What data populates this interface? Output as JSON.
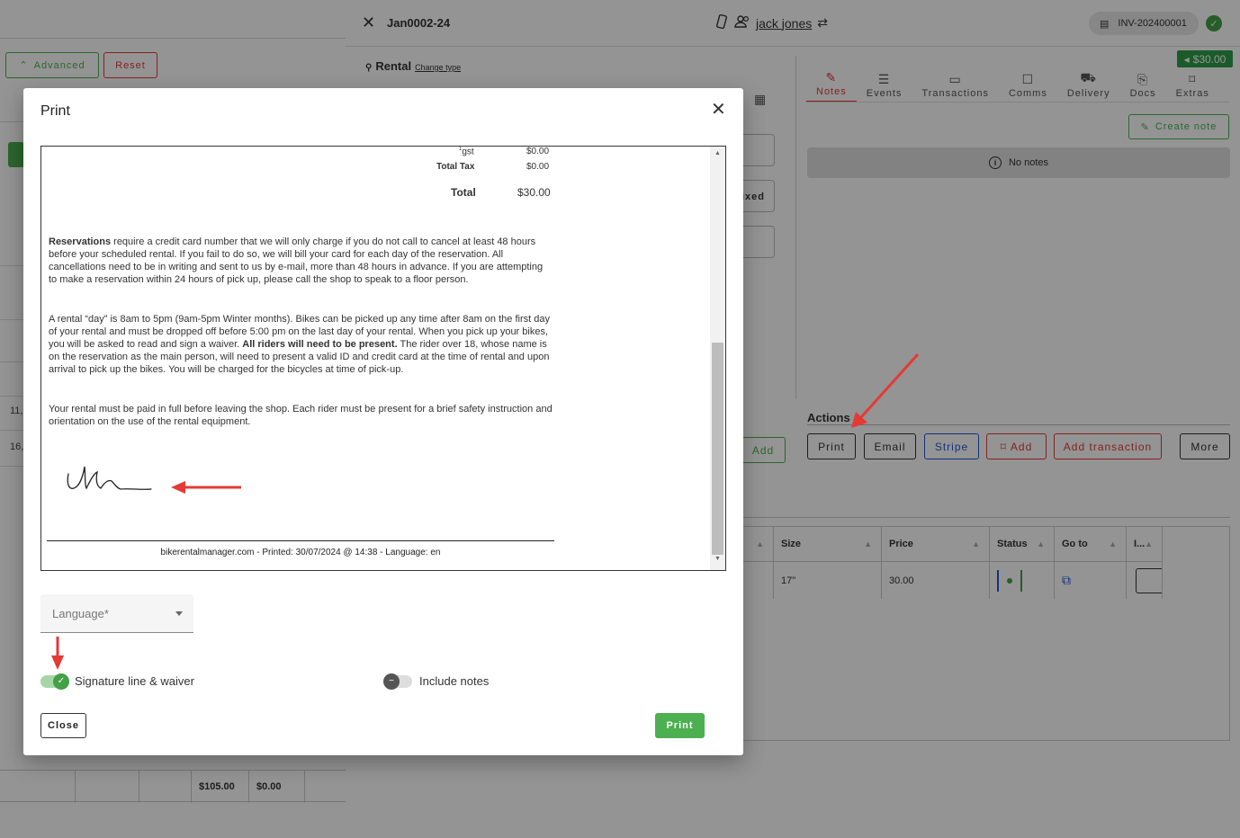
{
  "background": {
    "left": {
      "advanced_label": "Advanced",
      "reset_label": "Reset",
      "row_values": [
        "11,",
        "16,"
      ],
      "totals": [
        "$105.00",
        "$0.00"
      ]
    },
    "header": {
      "reservation_id": "Jan0002-24",
      "customer_name": "jack jones",
      "invoice_number": "INV-202400001",
      "price_badge": "$30.00"
    },
    "rental": {
      "type_label": "Rental",
      "change_type_label": "Change type",
      "fixed_label": "ixed",
      "add_label": "Add"
    },
    "tabs": [
      {
        "label": "Notes",
        "icon": "note-icon"
      },
      {
        "label": "Events",
        "icon": "events-icon"
      },
      {
        "label": "Transactions",
        "icon": "transactions-icon"
      },
      {
        "label": "Comms",
        "icon": "comms-icon"
      },
      {
        "label": "Delivery",
        "icon": "truck-icon"
      },
      {
        "label": "Docs",
        "icon": "docs-icon"
      },
      {
        "label": "Extras",
        "icon": "extras-icon"
      }
    ],
    "notes": {
      "create_label": "Create note",
      "empty_label": "No notes"
    },
    "actions": {
      "title": "Actions",
      "print": "Print",
      "email": "Email",
      "stripe": "Stripe",
      "add": "Add",
      "add_transaction": "Add transaction",
      "more": "More"
    },
    "table": {
      "headers": [
        "Size",
        "Price",
        "Status",
        "Go to",
        "I..."
      ],
      "row": {
        "size": "17\"",
        "price": "30.00"
      }
    }
  },
  "dialog": {
    "title": "Print",
    "preview": {
      "gst_label": "gst",
      "gst_value": "$0.00",
      "total_tax_label": "Total Tax",
      "total_tax_value": "$0.00",
      "total_label": "Total",
      "total_value": "$30.00",
      "para1_bold": "Reservations",
      "para1": " require a credit card number that we will only charge if you do not call to cancel at least 48 hours before your scheduled rental. If you fail to do so, we will bill your card for each day of the reservation. All cancellations need to be in writing and sent to us by e-mail, more than 48 hours in advance. If you are attempting to make a reservation within 24 hours of pick up, please call the shop to speak to a floor person.",
      "para2_a": "A rental “day” is 8am to 5pm (9am-5pm Winter months). Bikes can be picked up any time after 8am on the first day of your rental and must be dropped off before 5:00 pm on the last day of your rental. When you pick up your bikes, you will be asked to read and sign a waiver. ",
      "para2_bold": "All riders will need to be present.",
      "para2_b": "  The rider over 18, whose name is on the reservation as the main person, will need to present a valid ID and credit card at the time of rental and upon arrival to pick up the bikes. You will be charged for the bicycles at time of pick-up.",
      "para3": "Your rental must be paid in full before leaving the shop. Each rider must be present for a brief safety instruction and orientation on the use of the rental equipment.",
      "footer": "bikerentalmanager.com - Printed: 30/07/2024 @ 14:38 - Language: en"
    },
    "language_placeholder": "Language*",
    "signature_toggle_label": "Signature line & waiver",
    "signature_toggle_on": true,
    "notes_toggle_label": "Include notes",
    "notes_toggle_on": false,
    "close_label": "Close",
    "print_label": "Print"
  },
  "colors": {
    "accent_green": "#4caf50",
    "danger_red": "#e53935",
    "annotation_red": "#e53935",
    "stripe_blue": "#1e5bd6"
  }
}
